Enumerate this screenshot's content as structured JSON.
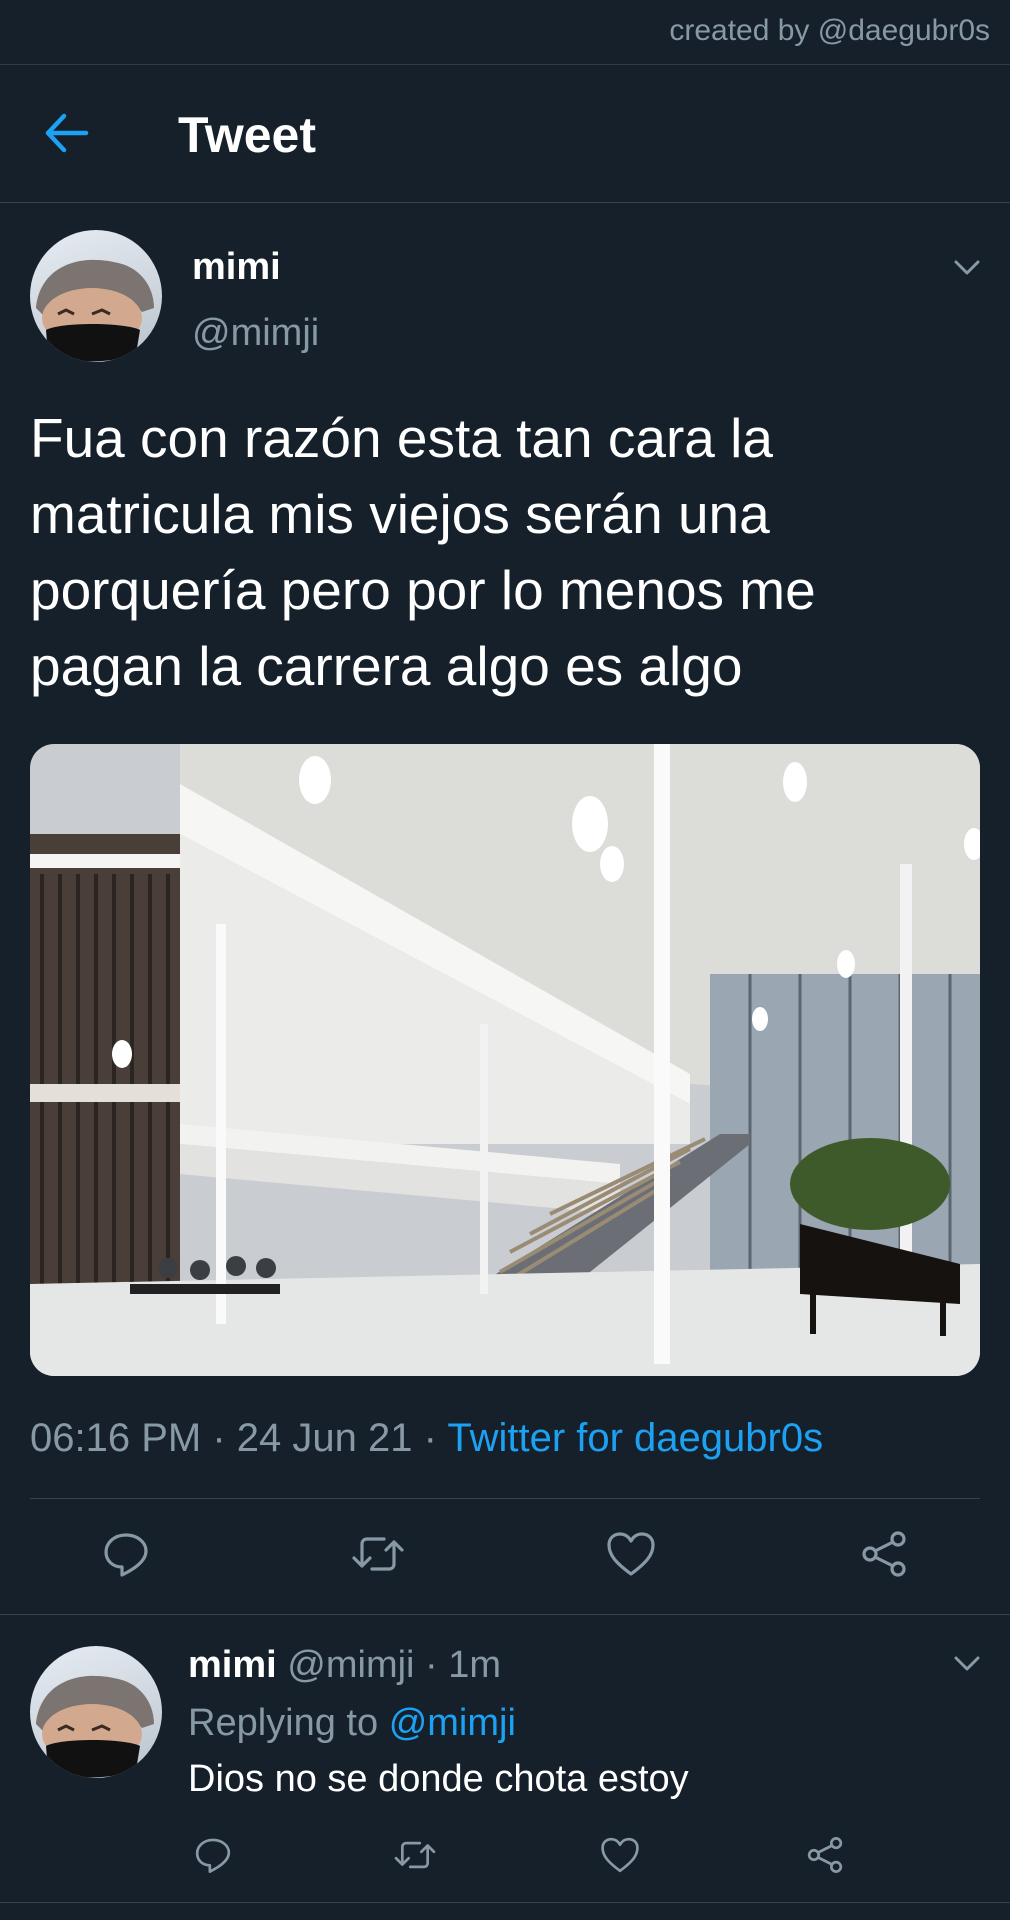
{
  "credit": "created by @daegubr0s",
  "header": {
    "title": "Tweet"
  },
  "tweet": {
    "name": "mimi",
    "handle": "@mimji",
    "text": "Fua con razón esta tan cara la matricula mis viejos serán una porquería pero por lo menos me pagan la carrera algo es algo",
    "time": "06:16 PM",
    "date": "24 Jun 21",
    "dot": "·",
    "source": "Twitter for daegubr0s"
  },
  "reply": {
    "name": "mimi",
    "handle": "@mimji",
    "time": "1m",
    "dot": "·",
    "replying_label": "Replying to",
    "replying_handle": "@mimji",
    "text": "Dios no se donde chota estoy"
  },
  "colors": {
    "background": "#15202b",
    "accent": "#1da1f2",
    "secondary_text": "#8899a6",
    "divider": "#38444d"
  },
  "icons": {
    "back": "arrow-left-icon",
    "more": "chevron-down-icon",
    "reply": "reply-icon",
    "retweet": "retweet-icon",
    "like": "heart-icon",
    "share": "share-icon"
  }
}
